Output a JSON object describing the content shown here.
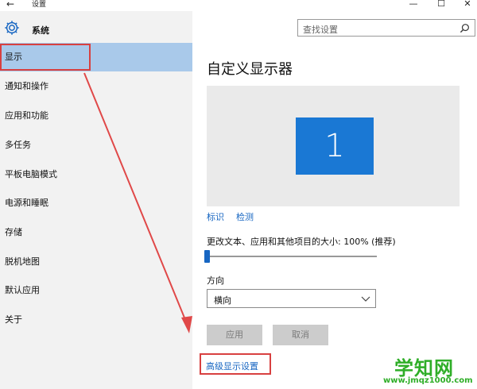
{
  "titlebar": {
    "back_glyph": "←",
    "title": "设置",
    "minimize_glyph": "—",
    "maximize_glyph": "☐",
    "close_glyph": "✕"
  },
  "sidebar": {
    "header_label": "系统",
    "header_icon": "gear-icon",
    "items": [
      {
        "label": "显示",
        "selected": true
      },
      {
        "label": "通知和操作"
      },
      {
        "label": "应用和功能"
      },
      {
        "label": "多任务"
      },
      {
        "label": "平板电脑模式"
      },
      {
        "label": "电源和睡眠"
      },
      {
        "label": "存储"
      },
      {
        "label": "脱机地图"
      },
      {
        "label": "默认应用"
      },
      {
        "label": "关于"
      }
    ]
  },
  "search": {
    "placeholder": "查找设置",
    "icon": "search-icon"
  },
  "main": {
    "title": "自定义显示器",
    "monitor_number": "1",
    "identify_link": "标识",
    "detect_link": "检测",
    "scale_label": "更改文本、应用和其他项目的大小: 100% (推荐)",
    "scale_value_percent": 0,
    "orientation_label": "方向",
    "orientation_value": "横向",
    "apply_label": "应用",
    "cancel_label": "取消",
    "advanced_link": "高级显示设置"
  },
  "watermark": {
    "main": "学知网",
    "sub": "www.jmqz1000.com"
  },
  "colors": {
    "accent": "#1766c2",
    "monitor": "#1a78d4",
    "selected_bg": "#a9c9ea",
    "annotation_red": "#d84040",
    "watermark_green": "#2fae28"
  }
}
